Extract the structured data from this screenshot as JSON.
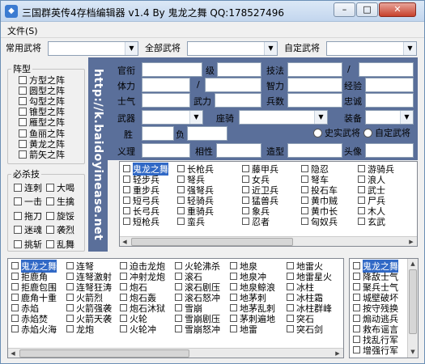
{
  "window": {
    "title": "三国群英传4存档编辑器 v1.4 By 鬼龙之舞 QQ:178527496",
    "min": "–",
    "max": "□",
    "close": "✕"
  },
  "menu": {
    "file": "文件(S)"
  },
  "toprow": {
    "common": "常用武将",
    "all": "全部武将",
    "custom": "自定武将"
  },
  "formation": {
    "title": "阵型",
    "items": [
      "方型之阵",
      "圆型之阵",
      "勾型之阵",
      "锥型之阵",
      "雁型之阵",
      "鱼丽之阵",
      "黄龙之阵",
      "箭矢之阵"
    ]
  },
  "specials": {
    "title": "必杀技",
    "items": [
      "连刺",
      "大喝",
      "一击",
      "生擒",
      "拖刀",
      "旋馁",
      "迷魂",
      "袭烈",
      "挑斩",
      "乱舞"
    ]
  },
  "watermark": "http://k.baidoyinease.net",
  "fields": {
    "guan": "官衔",
    "ji": "级",
    "jingyan": "经验",
    "tili": "体力",
    "zhili": "智力",
    "shiqi": "士气",
    "wuli": "武力",
    "bingshu": "兵数",
    "zhongcheng": "忠诚",
    "wuqi": "武器",
    "zuoji": "座骑",
    "zhuangbei": "装备",
    "sheng": "胜",
    "fu": "负",
    "yili": "义理",
    "xiangxing": "相性",
    "zaoxing": "造型",
    "touxiang": "头像",
    "jifa": "技法",
    "slash": "/"
  },
  "radios": {
    "history": "史实武将",
    "custom": "自定武将"
  },
  "troops": [
    "鬼龙之舞",
    "长枪兵",
    "藤甲兵",
    "隐忍",
    "游骑兵",
    "轻步兵",
    "弩兵",
    "女兵",
    "弩车",
    "浪人",
    "重步兵",
    "强弩兵",
    "近卫兵",
    "投石车",
    "武士",
    "短弓兵",
    "轻骑兵",
    "猛兽兵",
    "黄巾贼",
    "尸兵",
    "长弓兵",
    "重骑兵",
    "象兵",
    "黄巾长",
    "木人",
    "短枪兵",
    "蛮兵",
    "忍者",
    "匈奴兵",
    "玄武"
  ],
  "skills": [
    "鬼龙之舞",
    "连弩",
    "迫击龙炮",
    "火轮沸杀",
    "地泉",
    "地雷火",
    "拒鹿角",
    "连弩激射",
    "冲射龙炮",
    "滚石",
    "地泉冲",
    "地雷星火",
    "拒鹿包围",
    "连弩狂涛",
    "炮石",
    "滚石剧压",
    "地泉鲸浪",
    "冰柱",
    "鹿角十重",
    "火箭烈",
    "炮石轰",
    "滚石怒冲",
    "地茅刺",
    "冰柱霜",
    "赤焰",
    "火箭强袭",
    "炮石沐狱",
    "雪崩",
    "地茅乱刺",
    "冰柱群峰",
    "赤焰焚",
    "火箭天袭",
    "火轮",
    "雪崩剧压",
    "茅刺遍地",
    "突石",
    "赤焰火海",
    "龙炮",
    "火轮冲",
    "雪崩怒冲",
    "地雷",
    "突石剑"
  ],
  "extras": [
    "鬼龙之舞",
    "降敌士气",
    "聚兵士气",
    "城壁破坏",
    "按守残换",
    "煽动逃兵",
    "救布谣言",
    "找乱行军",
    "增强行军"
  ]
}
